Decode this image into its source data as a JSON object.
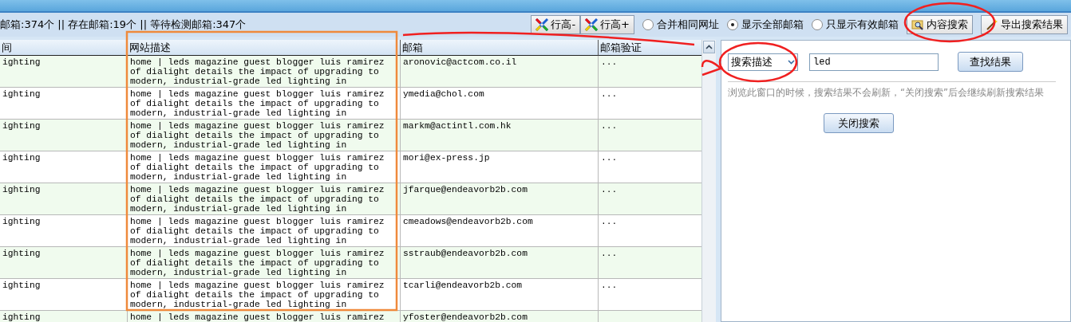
{
  "status_text": "邮箱:374个 || 存在邮箱:19个 || 等待检测邮箱:347个",
  "toolbar": {
    "buttons": [
      {
        "kind": "row-height",
        "label": "行高-"
      },
      {
        "kind": "row-height",
        "label": "行高+"
      }
    ],
    "radios": [
      {
        "label": "合并相同网址",
        "selected": false
      },
      {
        "label": "显示全部邮箱",
        "selected": true
      },
      {
        "label": "只显示有效邮箱",
        "selected": false
      }
    ],
    "actions": [
      {
        "kind": "search",
        "label": "内容搜索"
      },
      {
        "kind": "export",
        "label": "导出搜索结果"
      }
    ]
  },
  "table": {
    "columns": [
      "间",
      "网站描述",
      "邮箱",
      "邮箱验证"
    ],
    "rows": [
      {
        "column_1": "ighting",
        "description": "home | leds magazine guest blogger luis ramirez\nof dialight details the impact of upgrading to\nmodern, industrial-grade led lighting in",
        "email": "aronovic@actcom.co.il",
        "verify": "..."
      },
      {
        "column_1": "ighting",
        "description": "home | leds magazine guest blogger luis ramirez\nof dialight details the impact of upgrading to\nmodern, industrial-grade led lighting in",
        "email": "ymedia@chol.com",
        "verify": "..."
      },
      {
        "column_1": "ighting",
        "description": "home | leds magazine guest blogger luis ramirez\nof dialight details the impact of upgrading to\nmodern, industrial-grade led lighting in",
        "email": "markm@actintl.com.hk",
        "verify": "..."
      },
      {
        "column_1": "ighting",
        "description": "home | leds magazine guest blogger luis ramirez\nof dialight details the impact of upgrading to\nmodern, industrial-grade led lighting in",
        "email": "mori@ex-press.jp",
        "verify": "..."
      },
      {
        "column_1": "ighting",
        "description": "home | leds magazine guest blogger luis ramirez\nof dialight details the impact of upgrading to\nmodern, industrial-grade led lighting in",
        "email": "jfarque@endeavorb2b.com",
        "verify": "..."
      },
      {
        "column_1": "ighting",
        "description": "home | leds magazine guest blogger luis ramirez\nof dialight details the impact of upgrading to\nmodern, industrial-grade led lighting in",
        "email": "cmeadows@endeavorb2b.com",
        "verify": "..."
      },
      {
        "column_1": "ighting",
        "description": "home | leds magazine guest blogger luis ramirez\nof dialight details the impact of upgrading to\nmodern, industrial-grade led lighting in",
        "email": "sstraub@endeavorb2b.com",
        "verify": "..."
      },
      {
        "column_1": "ighting",
        "description": "home | leds magazine guest blogger luis ramirez\nof dialight details the impact of upgrading to\nmodern, industrial-grade led lighting in",
        "email": "tcarli@endeavorb2b.com",
        "verify": "..."
      },
      {
        "column_1": "ighting",
        "description": "home | leds magazine guest blogger luis ramirez",
        "email": "yfoster@endeavorb2b.com"
      }
    ]
  },
  "search_panel": {
    "field_select": "搜索描述",
    "query": "led",
    "find_button": "查找结果",
    "note": "浏览此窗口的时候，搜索结果不会刷新，“关闭搜索”后会继续刷新搜索结果",
    "close_button": "关闭搜索"
  }
}
